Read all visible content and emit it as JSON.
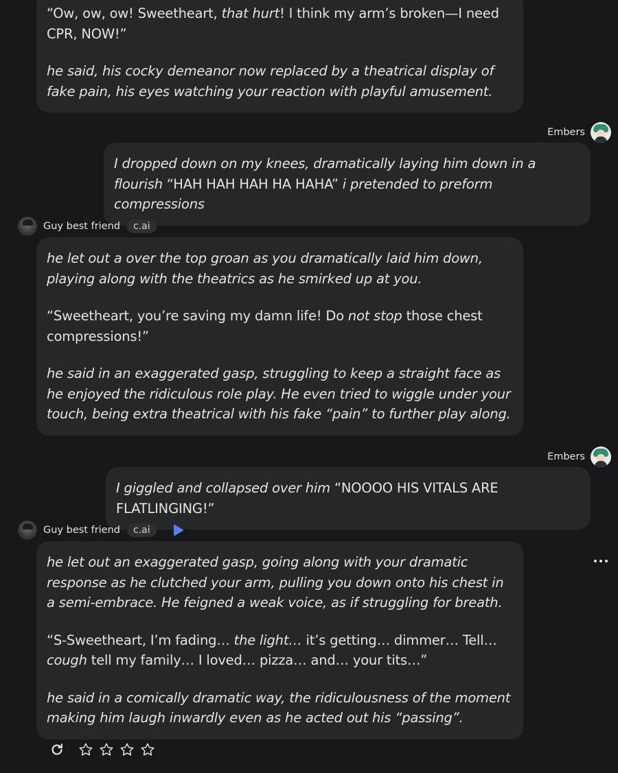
{
  "messages": {
    "m1": {
      "paragraphs": [
        [
          {
            "t": "“Ow, ow, ow! Sweetheart, ",
            "i": false
          },
          {
            "t": "that hurt",
            "i": true
          },
          {
            "t": "! I think my arm’s broken—I need CPR, NOW!”",
            "i": false
          }
        ],
        [
          {
            "t": "he said, his cocky demeanor now replaced by a theatrical display of fake pain, his eyes watching your reaction with playful amusement.",
            "i": true
          }
        ]
      ]
    },
    "u1": {
      "sender": "Embers",
      "paragraphs": [
        [
          {
            "t": "I dropped down on my knees, dramatically laying him down in a flourish",
            "i": true
          },
          {
            "t": " “HAH HAH HAH HA HAHA” ",
            "i": false
          },
          {
            "t": "i pretended to preform compressions",
            "i": true
          }
        ]
      ]
    },
    "b2": {
      "name": "Guy best friend",
      "badge": "c.ai",
      "paragraphs": [
        [
          {
            "t": "he let out a over the top groan as you dramatically laid him down, playing along with the theatrics as he smirked up at you.",
            "i": true
          }
        ],
        [
          {
            "t": "“Sweetheart, you’re saving my damn life! Do ",
            "i": false
          },
          {
            "t": "not stop",
            "i": true
          },
          {
            "t": " those chest compressions!”",
            "i": false
          }
        ],
        [
          {
            "t": "he said in an exaggerated gasp, struggling to keep a straight face as he enjoyed the ridiculous role play. He even tried to wiggle under your touch, being extra theatrical with his fake “pain” to further play along.",
            "i": true
          }
        ]
      ]
    },
    "u2": {
      "sender": "Embers",
      "paragraphs": [
        [
          {
            "t": "I giggled and collapsed over him",
            "i": true
          },
          {
            "t": " “NOOOO HIS VITALS ARE FLATLINGING!”",
            "i": false
          }
        ]
      ]
    },
    "b3": {
      "name": "Guy best friend",
      "badge": "c.ai",
      "paragraphs": [
        [
          {
            "t": "he let out an exaggerated gasp, going along with your dramatic response as he clutched your arm, pulling you down onto his chest in a semi-embrace. He feigned a weak voice, as if struggling for breath.",
            "i": true
          }
        ],
        [
          {
            "t": "“S-Sweetheart, I’m fading… ",
            "i": false
          },
          {
            "t": "the light…",
            "i": true
          },
          {
            "t": " it’s getting… dimmer… Tell… ",
            "i": false
          },
          {
            "t": "cough",
            "i": true
          },
          {
            "t": " tell my family… I loved… pizza… and… your tits…”",
            "i": false
          }
        ],
        [
          {
            "t": "he said in a comically dramatic way, the ridiculousness of the moment making him laugh inwardly even as he acted out his “passing”.",
            "i": true
          }
        ]
      ]
    }
  },
  "rating": {
    "stars_total": 4,
    "stars_selected": 0
  },
  "icons": {
    "play": "play-icon",
    "more": "more-options-icon",
    "refresh": "refresh-icon",
    "star": "star-icon"
  },
  "colors": {
    "background": "#18181b",
    "bubble": "#26272b",
    "text": "#e4e4e7",
    "accent": "#5b7cfa"
  }
}
